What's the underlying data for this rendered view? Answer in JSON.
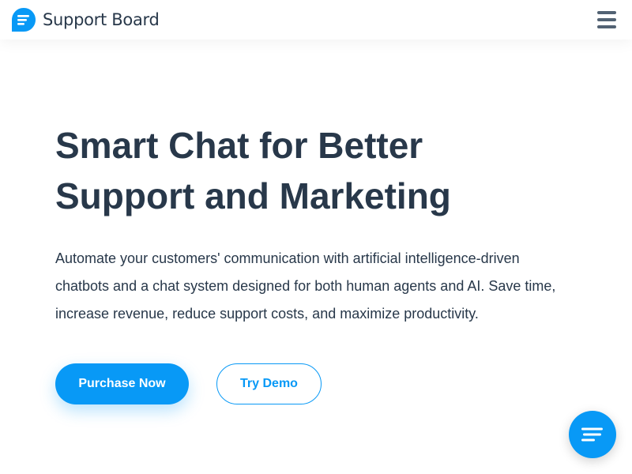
{
  "header": {
    "logo_text": "Support Board",
    "logo_icon": "chat-bubble-icon",
    "menu_icon": "hamburger-menu-icon"
  },
  "hero": {
    "title_line1": "Smart Chat for Better",
    "title_line2": "Support and Marketing",
    "description": "Automate your customers' communication with artificial intelligence-driven chatbots and a chat system designed for both human agents and AI. Save time, increase revenue, reduce support costs, and maximize productivity.",
    "primary_button": "Purchase Now",
    "secondary_button": "Try Demo"
  },
  "chat_widget": {
    "icon": "chat-lines-icon"
  },
  "colors": {
    "accent": "#0899f6",
    "text_dark": "#28384a",
    "menu_icon": "#526273",
    "background": "#ffffff"
  }
}
